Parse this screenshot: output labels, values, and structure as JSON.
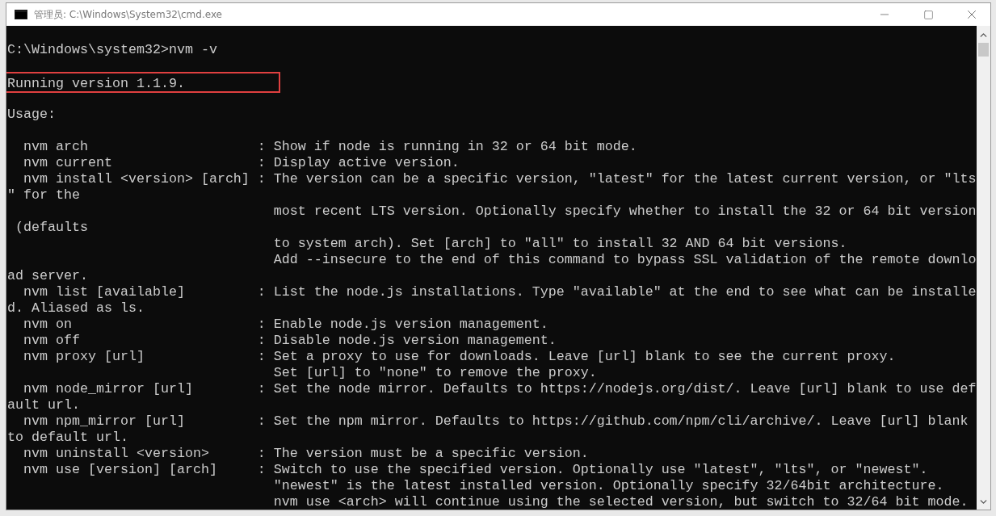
{
  "window": {
    "title": "管理员: C:\\Windows\\System32\\cmd.exe"
  },
  "console": {
    "lines": [
      {
        "kind": "text",
        "text": "C:\\Windows\\system32>nvm -v",
        "highlighted": false
      },
      {
        "kind": "blank"
      },
      {
        "kind": "text",
        "text": "Running version 1.1.9.",
        "highlighted": true
      },
      {
        "kind": "blank"
      },
      {
        "kind": "text",
        "text": "Usage:",
        "highlighted": false
      },
      {
        "kind": "blank"
      },
      {
        "kind": "text",
        "text": "  nvm arch                     : Show if node is running in 32 or 64 bit mode.",
        "highlighted": false
      },
      {
        "kind": "text",
        "text": "  nvm current                  : Display active version.",
        "highlighted": false
      },
      {
        "kind": "text",
        "text": "  nvm install <version> [arch] : The version can be a specific version, \"latest\" for the latest current version, or \"lts",
        "highlighted": false
      },
      {
        "kind": "text",
        "text": "\" for the",
        "highlighted": false
      },
      {
        "kind": "text",
        "text": "                                 most recent LTS version. Optionally specify whether to install the 32 or 64 bit version",
        "highlighted": false
      },
      {
        "kind": "text",
        "text": " (defaults",
        "highlighted": false
      },
      {
        "kind": "text",
        "text": "                                 to system arch). Set [arch] to \"all\" to install 32 AND 64 bit versions.",
        "highlighted": false
      },
      {
        "kind": "text",
        "text": "                                 Add --insecure to the end of this command to bypass SSL validation of the remote downlo",
        "highlighted": false
      },
      {
        "kind": "text",
        "text": "ad server.",
        "highlighted": false
      },
      {
        "kind": "text",
        "text": "  nvm list [available]         : List the node.js installations. Type \"available\" at the end to see what can be installe",
        "highlighted": false
      },
      {
        "kind": "text",
        "text": "d. Aliased as ls.",
        "highlighted": false
      },
      {
        "kind": "text",
        "text": "  nvm on                       : Enable node.js version management.",
        "highlighted": false
      },
      {
        "kind": "text",
        "text": "  nvm off                      : Disable node.js version management.",
        "highlighted": false
      },
      {
        "kind": "text",
        "text": "  nvm proxy [url]              : Set a proxy to use for downloads. Leave [url] blank to see the current proxy.",
        "highlighted": false
      },
      {
        "kind": "text",
        "text": "                                 Set [url] to \"none\" to remove the proxy.",
        "highlighted": false
      },
      {
        "kind": "text",
        "text": "  nvm node_mirror [url]        : Set the node mirror. Defaults to https://nodejs.org/dist/. Leave [url] blank to use def",
        "highlighted": false
      },
      {
        "kind": "text",
        "text": "ault url.",
        "highlighted": false
      },
      {
        "kind": "text",
        "text": "  nvm npm_mirror [url]         : Set the npm mirror. Defaults to https://github.com/npm/cli/archive/. Leave [url] blank",
        "highlighted": false
      },
      {
        "kind": "text",
        "text": "to default url.",
        "highlighted": false
      },
      {
        "kind": "text",
        "text": "  nvm uninstall <version>      : The version must be a specific version.",
        "highlighted": false
      },
      {
        "kind": "text",
        "text": "  nvm use [version] [arch]     : Switch to use the specified version. Optionally use \"latest\", \"lts\", or \"newest\".",
        "highlighted": false
      },
      {
        "kind": "text",
        "text": "                                 \"newest\" is the latest installed version. Optionally specify 32/64bit architecture.",
        "highlighted": false
      },
      {
        "kind": "text",
        "text": "                                 nvm use <arch> will continue using the selected version, but switch to 32/64 bit mode.",
        "highlighted": false
      }
    ]
  }
}
